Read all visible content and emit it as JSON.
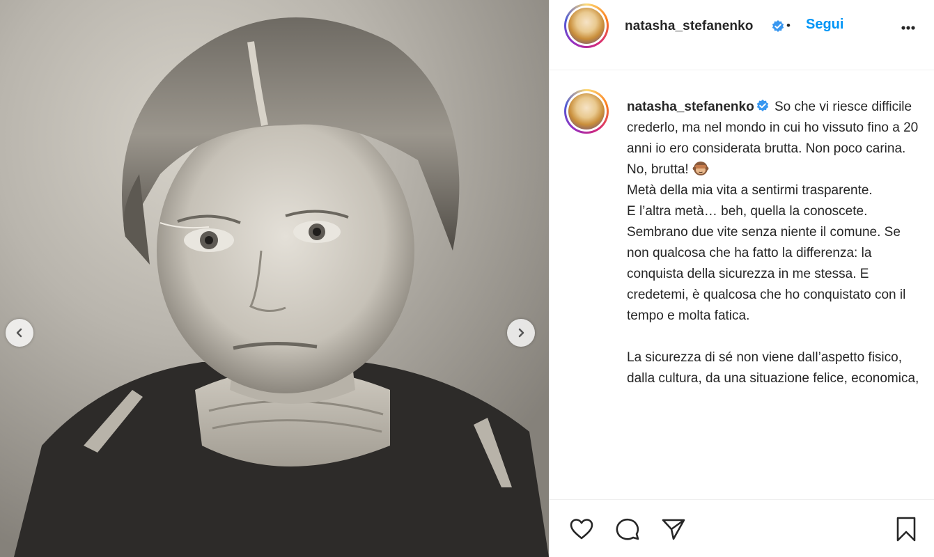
{
  "post": {
    "username": "natasha_stefanenko",
    "verified_icon": "verified-badge-icon",
    "dot": "•",
    "follow_label": "Segui",
    "more_icon": "more-options-icon"
  },
  "caption": {
    "username": "natasha_stefanenko",
    "lines": [
      "So che vi riesce difficile crederlo, ma nel mondo in cui ho vissuto fino a 20 anni io ero considerata brutta. Non poco carina.",
      "No, brutta!",
      "Metà della mia vita a sentirmi trasparente.",
      "E l’altra metà… beh, quella la conoscete.",
      "Sembrano due vite senza niente il comune. Se non qualcosa che ha fatto la differenza: la conquista della sicurezza in me stessa. E credetemi, è qualcosa che ho conquistato con il tempo e molta fatica.",
      "La sicurezza di sé non viene dall’aspetto fisico, dalla cultura, da una situazione felice, economica,"
    ],
    "emoji": "see-no-evil-monkey-emoji"
  },
  "media": {
    "prev_icon": "chevron-left-icon",
    "next_icon": "chevron-right-icon"
  },
  "actions": {
    "like_icon": "heart-icon",
    "comment_icon": "comment-icon",
    "share_icon": "share-icon",
    "save_icon": "bookmark-icon"
  },
  "colors": {
    "link_blue": "#0095f6",
    "text": "#262626",
    "verified": "#3897f0"
  }
}
